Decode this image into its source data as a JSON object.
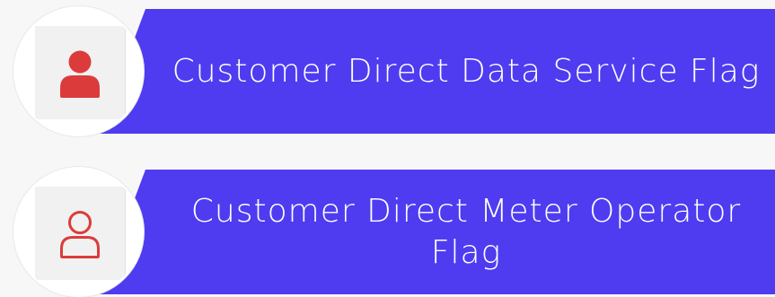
{
  "items": [
    {
      "title": "Customer Direct Data Service Flag",
      "icon": "user-solid-icon"
    },
    {
      "title": "Customer Direct Meter Operator Flag",
      "icon": "user-outline-icon"
    }
  ],
  "colors": {
    "banner": "#4f3cf0",
    "icon": "#dc3b3b",
    "background": "#f7f7f7"
  }
}
